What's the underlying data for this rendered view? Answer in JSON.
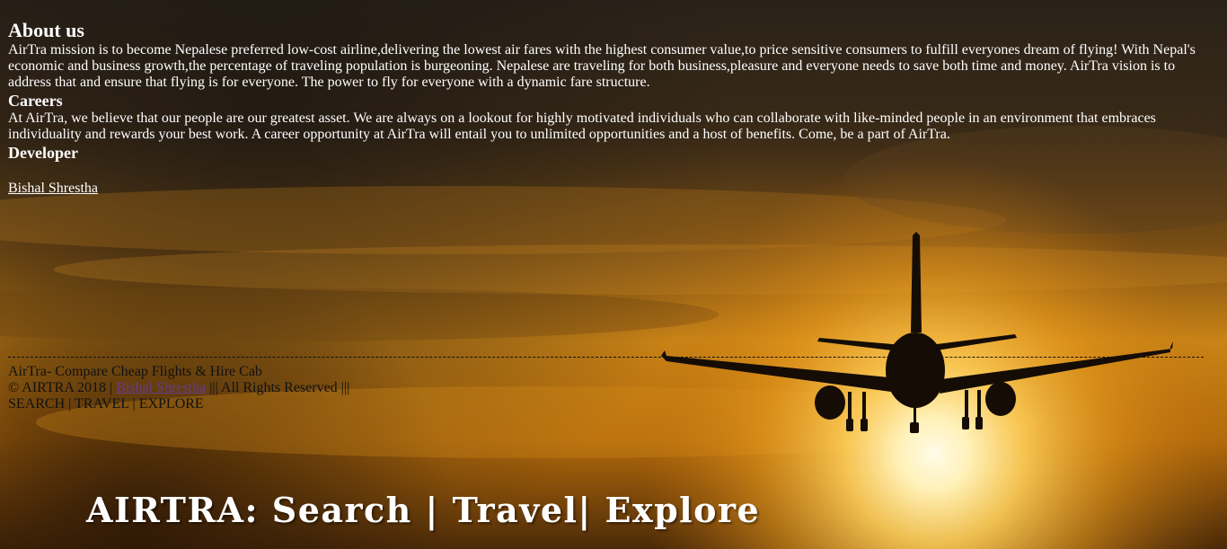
{
  "about": {
    "title": "About us",
    "text": "AirTra mission is to become Nepalese preferred low-cost airline,delivering the lowest air fares with the highest consumer value,to price sensitive consumers to fulfill everyones dream of flying! With Nepal's economic and business growth,the percentage of traveling population is burgeoning. Nepalese are traveling for both business,pleasure and everyone needs to save both time and money. AirTra vision is to address that and ensure that flying is for everyone. The power to fly for everyone with a dynamic fare structure."
  },
  "careers": {
    "title": "Careers",
    "text": "At AirTra, we believe that our people are our greatest asset. We are always on a lookout for highly motivated individuals who can collaborate with like-minded people in an environment that embraces individuality and rewards your best work. A career opportunity at AirTra will entail you to unlimited opportunities and a host of benefits. Come, be a part of AirTra."
  },
  "developer": {
    "title": "Developer",
    "link": "Bishal Shrestha"
  },
  "footer": {
    "line1": "AirTra- Compare Cheap Flights & Hire Cab",
    "copyright_prefix": "© AIRTRA 2018 |",
    "copyright_link": "Bishal Shrestha",
    "copyright_suffix": "||| All Rights Reserved |||",
    "tagline": "SEARCH | TRAVEL | EXPLORE"
  },
  "banner": {
    "text": "AIRTRA: Search | Travel| Explore"
  },
  "colors": {
    "sky_top": "#2b2116",
    "sky_mid": "#b5700f",
    "sun": "#fff7d8",
    "text": "#ffffff",
    "footer_text": "#111111",
    "footer_link": "#6a3a8c"
  }
}
